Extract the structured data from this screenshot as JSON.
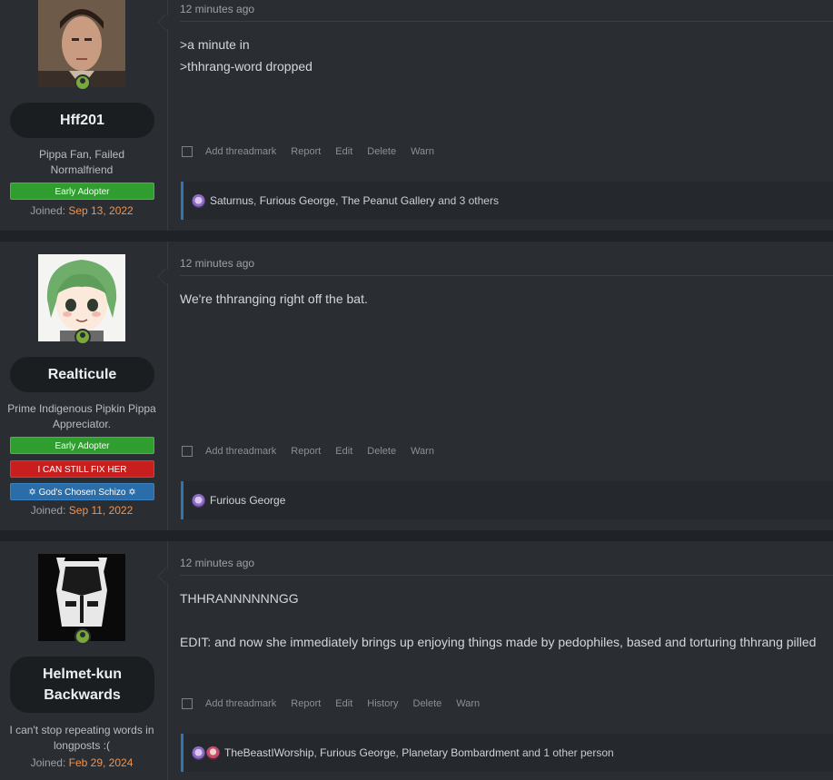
{
  "posts": [
    {
      "username": "Hff201",
      "title": "Pippa Fan, Failed Normalfriend",
      "banners": [
        "Early Adopter"
      ],
      "joined_label": "Joined:",
      "joined_date": "Sep 13, 2022",
      "time": "12 minutes ago",
      "body": [
        ">a minute in",
        ">thhrang-word dropped"
      ],
      "actions": [
        "Add threadmark",
        "Report",
        "Edit",
        "Delete",
        "Warn"
      ],
      "reactions": {
        "names": [
          "Saturnus",
          "Furious George",
          "The Peanut Gallery"
        ],
        "trail": " and 3 others"
      }
    },
    {
      "username": "Realticule",
      "title": "Prime Indigenous Pipkin Pippa Appreciator.",
      "banners": [
        "Early Adopter",
        "I CAN STILL FIX HER",
        "✡ God's Chosen Schizo ✡"
      ],
      "joined_label": "Joined:",
      "joined_date": "Sep 11, 2022",
      "time": "12 minutes ago",
      "body": [
        "We're thhranging right off the bat."
      ],
      "actions": [
        "Add threadmark",
        "Report",
        "Edit",
        "Delete",
        "Warn"
      ],
      "reactions": {
        "names": [
          "Furious George"
        ],
        "trail": ""
      }
    },
    {
      "username": "Helmet-kun Backwards",
      "title": "I can't stop repeating words in longposts :(",
      "banners": [],
      "joined_label": "Joined:",
      "joined_date": "Feb 29, 2024",
      "time": "12 minutes ago",
      "body": [
        "THHRANNNNNNGG",
        "",
        "EDIT: and now she immediately brings up enjoying things made by pedophiles, based and torturing thhrang pilled"
      ],
      "actions": [
        "Add threadmark",
        "Report",
        "Edit",
        "History",
        "Delete",
        "Warn"
      ],
      "reactions": {
        "names": [
          "TheBeastIWorship",
          "Furious George",
          "Planetary Bombardment"
        ],
        "trail": " and 1 other person"
      }
    }
  ],
  "colors": {
    "page_bg": "#1f2226",
    "post_bg": "#2a2e33",
    "accent_link": "#f0934e",
    "reaction_bar": "#2f75b5",
    "banner_green": "#2f9e2f",
    "banner_red": "#c81e1e",
    "banner_blue": "#2b6da8"
  }
}
